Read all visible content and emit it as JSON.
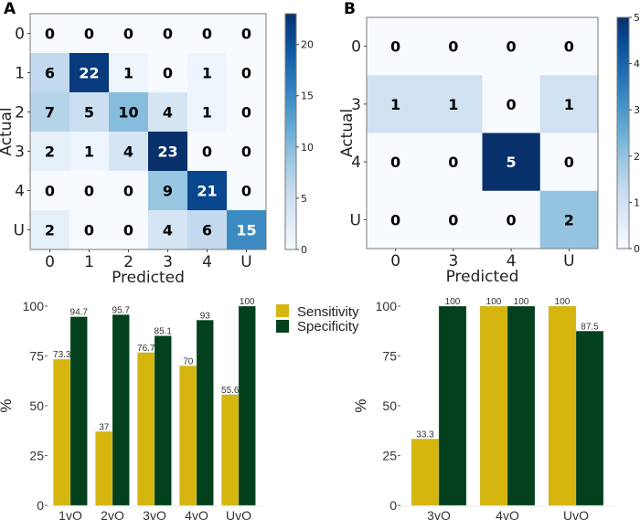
{
  "panels": {
    "A": {
      "letter": "A"
    },
    "B": {
      "letter": "B"
    }
  },
  "legend": {
    "items": [
      {
        "label": "Sensitivity",
        "color": "#d6b50f"
      },
      {
        "label": "Specificity",
        "color": "#03401e"
      }
    ]
  },
  "chart_data": [
    {
      "id": "A-heatmap",
      "type": "heatmap",
      "title": "",
      "xlabel": "Predicted",
      "ylabel": "Actual",
      "x_categories": [
        "0",
        "1",
        "2",
        "3",
        "4",
        "U"
      ],
      "y_categories": [
        "0",
        "1",
        "2",
        "3",
        "4",
        "U"
      ],
      "values": [
        [
          0,
          0,
          0,
          0,
          0,
          0
        ],
        [
          6,
          22,
          1,
          0,
          1,
          0
        ],
        [
          7,
          5,
          10,
          4,
          1,
          0
        ],
        [
          2,
          1,
          4,
          23,
          0,
          0
        ],
        [
          0,
          0,
          0,
          9,
          21,
          0
        ],
        [
          2,
          0,
          0,
          4,
          6,
          15
        ]
      ],
      "colormap": "Blues",
      "colorbar": {
        "range": [
          0,
          23
        ],
        "ticks": [
          0,
          5,
          10,
          15,
          20
        ]
      }
    },
    {
      "id": "B-heatmap",
      "type": "heatmap",
      "title": "",
      "xlabel": "Predicted",
      "ylabel": "Actual",
      "x_categories": [
        "0",
        "3",
        "4",
        "U"
      ],
      "y_categories": [
        "0",
        "3",
        "4",
        "U"
      ],
      "values": [
        [
          0,
          0,
          0,
          0
        ],
        [
          1,
          1,
          0,
          1
        ],
        [
          0,
          0,
          5,
          0
        ],
        [
          0,
          0,
          0,
          2
        ]
      ],
      "colormap": "Blues",
      "colorbar": {
        "range": [
          0,
          5
        ],
        "ticks": [
          0,
          1,
          2,
          3,
          4,
          5
        ]
      }
    },
    {
      "id": "A-bars",
      "type": "bar",
      "title": "",
      "xlabel": "",
      "ylabel": "%",
      "categories": [
        "1vO",
        "2vO",
        "3vO",
        "4vO",
        "UvO"
      ],
      "series": [
        {
          "name": "Sensitivity",
          "values": [
            73.3,
            37,
            76.7,
            70,
            55.6
          ],
          "labels": [
            "73.3",
            "37",
            "76.7",
            "70",
            "55.6"
          ]
        },
        {
          "name": "Specificity",
          "values": [
            94.7,
            95.7,
            85.1,
            93,
            100
          ],
          "labels": [
            "94.7",
            "95.7",
            "85.1",
            "93",
            "100"
          ]
        }
      ],
      "ylim": [
        0,
        100
      ],
      "yticks": [
        "0",
        "25",
        "50",
        "75",
        "100"
      ],
      "legend": "right"
    },
    {
      "id": "B-bars",
      "type": "bar",
      "title": "",
      "xlabel": "",
      "ylabel": "%",
      "categories": [
        "3vO",
        "4vO",
        "UvO"
      ],
      "series": [
        {
          "name": "Sensitivity",
          "values": [
            33.3,
            100,
            100
          ],
          "labels": [
            "33.3",
            "100",
            "100"
          ]
        },
        {
          "name": "Specificity",
          "values": [
            100,
            100,
            87.5
          ],
          "labels": [
            "100",
            "100",
            "87.5"
          ]
        }
      ],
      "ylim": [
        0,
        100
      ],
      "yticks": [
        "0",
        "25",
        "50",
        "75",
        "100"
      ],
      "legend": "none"
    }
  ]
}
